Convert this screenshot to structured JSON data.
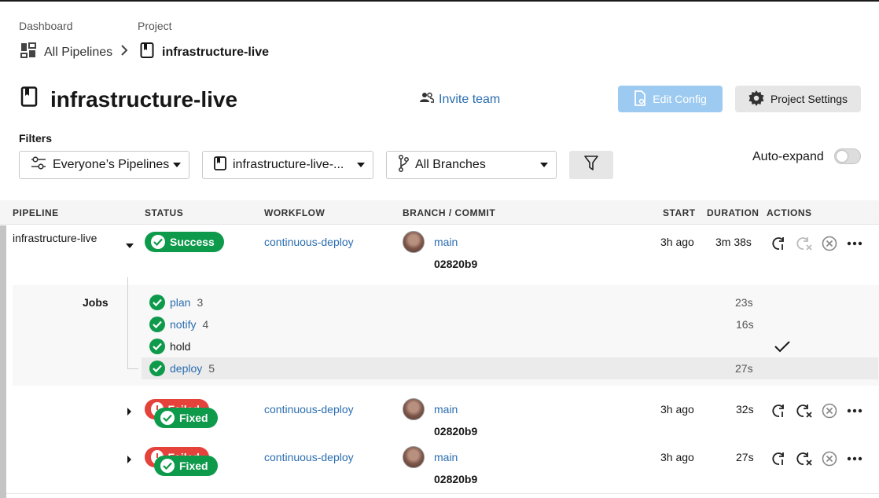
{
  "breadcrumbs": {
    "dashboard_label": "Dashboard",
    "project_label": "Project",
    "all_pipelines": "All Pipelines",
    "current_project": "infrastructure-live"
  },
  "header": {
    "title": "infrastructure-live",
    "invite_team": "Invite team",
    "edit_config": "Edit Config",
    "project_settings": "Project Settings"
  },
  "filters": {
    "label": "Filters",
    "pipelines_select": "Everyone’s Pipelines",
    "project_select": "infrastructure-live-...",
    "branch_select": "All Branches",
    "auto_expand": "Auto-expand",
    "auto_expand_on": false
  },
  "table": {
    "columns": {
      "pipeline": "PIPELINE",
      "status": "STATUS",
      "workflow": "WORKFLOW",
      "branch_commit": "BRANCH / COMMIT",
      "start": "START",
      "duration": "DURATION",
      "actions": "ACTIONS"
    },
    "rows": [
      {
        "pipeline": "infrastructure-live",
        "status": "Success",
        "workflow": "continuous-deploy",
        "branch": "main",
        "commit": "02820b9",
        "start": "3h ago",
        "duration": "3m 38s"
      },
      {
        "status_under": "Failed",
        "status": "Fixed",
        "workflow": "continuous-deploy",
        "branch": "main",
        "commit": "02820b9",
        "start": "3h ago",
        "duration": "32s"
      },
      {
        "status_under": "Failed",
        "status": "Fixed",
        "workflow": "continuous-deploy",
        "branch": "main",
        "commit": "02820b9",
        "start": "3h ago",
        "duration": "27s"
      }
    ],
    "jobs_label": "Jobs",
    "jobs": [
      {
        "name": "plan",
        "number": "3",
        "duration": "23s"
      },
      {
        "name": "notify",
        "number": "4",
        "duration": "16s"
      },
      {
        "name": "hold",
        "number": "",
        "duration": ""
      },
      {
        "name": "deploy",
        "number": "5",
        "duration": "27s"
      }
    ]
  },
  "colors": {
    "success": "#0e9a4b",
    "failed": "#e5423b",
    "link": "#2a6db0",
    "edit_config_bg": "#9ccaf0"
  }
}
